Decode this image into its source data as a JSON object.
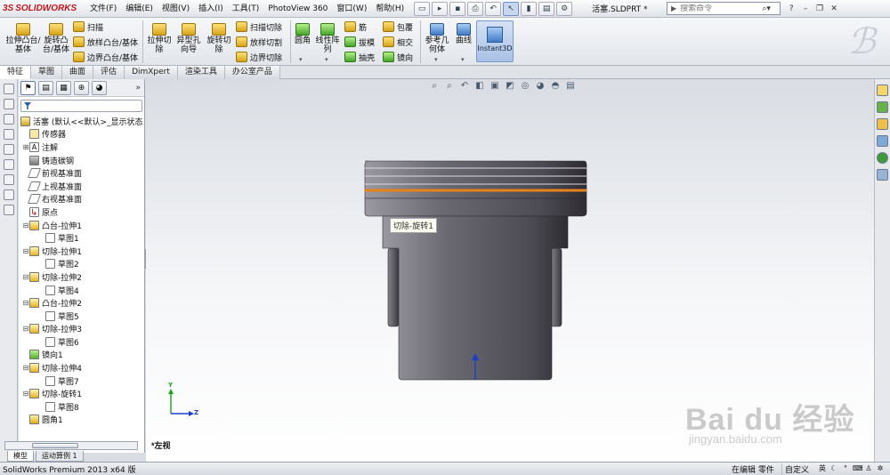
{
  "app": {
    "logo_text": "SOLIDWORKS",
    "logo_mark": "3S",
    "doc_title": "活塞.SLDPRT *",
    "search_placeholder": "搜索命令"
  },
  "menu": [
    "文件(F)",
    "编辑(E)",
    "视图(V)",
    "插入(I)",
    "工具(T)",
    "PhotoView 360",
    "窗口(W)",
    "帮助(H)"
  ],
  "commands": {
    "extrude_boss": "拉伸凸台/基体",
    "revolve_boss": "旋转凸台/基体",
    "sweep": "扫描",
    "loft": "放样凸台/基体",
    "boundary_boss": "边界凸台/基体",
    "extrude_cut": "拉伸切除",
    "hole_wizard": "异型孔向导",
    "revolve_cut": "旋转切除",
    "swept_cut": "扫描切除",
    "lofted_cut": "放样切割",
    "boundary_cut": "边界切除",
    "fillet": "圆角",
    "linear_pattern": "线性阵列",
    "rib": "筋",
    "draft": "拔模",
    "shell": "抽壳",
    "wrap": "包覆",
    "intersect": "相交",
    "mirror": "镜向",
    "ref_geometry": "参考几何体",
    "curves": "曲线",
    "instant3d": "Instant3D"
  },
  "tabs": [
    "特征",
    "草图",
    "曲面",
    "评估",
    "DimXpert",
    "渲染工具",
    "办公室产品"
  ],
  "tree": {
    "root": "活塞 (默认<<默认>_显示状态",
    "nodes": [
      {
        "label": "传感器",
        "icon": "sensor",
        "indent": 1,
        "exp": ""
      },
      {
        "label": "注解",
        "icon": "note",
        "indent": 1,
        "exp": "+"
      },
      {
        "label": "铸造碳钢",
        "icon": "mat",
        "indent": 1,
        "exp": ""
      },
      {
        "label": "前视基准面",
        "icon": "plane",
        "indent": 1,
        "exp": ""
      },
      {
        "label": "上视基准面",
        "icon": "plane",
        "indent": 1,
        "exp": ""
      },
      {
        "label": "右视基准面",
        "icon": "plane",
        "indent": 1,
        "exp": ""
      },
      {
        "label": "原点",
        "icon": "origin",
        "indent": 1,
        "exp": ""
      },
      {
        "label": "凸台-拉伸1",
        "icon": "feat",
        "indent": 1,
        "exp": "-"
      },
      {
        "label": "草图1",
        "icon": "sketch",
        "indent": 2,
        "exp": ""
      },
      {
        "label": "切除-拉伸1",
        "icon": "feat",
        "indent": 1,
        "exp": "-"
      },
      {
        "label": "草图2",
        "icon": "sketch",
        "indent": 2,
        "exp": ""
      },
      {
        "label": "切除-拉伸2",
        "icon": "feat",
        "indent": 1,
        "exp": "-"
      },
      {
        "label": "草图4",
        "icon": "sketch",
        "indent": 2,
        "exp": ""
      },
      {
        "label": "凸台-拉伸2",
        "icon": "feat",
        "indent": 1,
        "exp": "-"
      },
      {
        "label": "草图5",
        "icon": "sketch",
        "indent": 2,
        "exp": ""
      },
      {
        "label": "切除-拉伸3",
        "icon": "feat",
        "indent": 1,
        "exp": "-"
      },
      {
        "label": "草图6",
        "icon": "sketch",
        "indent": 2,
        "exp": ""
      },
      {
        "label": "镜向1",
        "icon": "mirror",
        "indent": 1,
        "exp": ""
      },
      {
        "label": "切除-拉伸4",
        "icon": "feat",
        "indent": 1,
        "exp": "-"
      },
      {
        "label": "草图7",
        "icon": "sketch",
        "indent": 2,
        "exp": ""
      },
      {
        "label": "切除-旋转1",
        "icon": "feat",
        "indent": 1,
        "exp": "-"
      },
      {
        "label": "草图8",
        "icon": "sketch",
        "indent": 2,
        "exp": ""
      },
      {
        "label": "圆角1",
        "icon": "fillet",
        "indent": 1,
        "exp": ""
      }
    ]
  },
  "bottom_tabs": [
    "模型",
    "运动算例 1"
  ],
  "viewport": {
    "view_name": "*左视",
    "tooltip": "切除-旋转1",
    "triad_y": "Y",
    "triad_z": "Z"
  },
  "status": {
    "left": "SolidWorks Premium 2013 x64 版",
    "editing": "在编辑 零件",
    "custom": "自定义",
    "ime": "英"
  },
  "watermark": {
    "word": "Bai du 经验",
    "url": "jingyan.baidu.com"
  },
  "colors": {
    "accent_orange": "#e8821a",
    "piston_body": "#5f5c63",
    "logo_red": "#c4161c"
  }
}
